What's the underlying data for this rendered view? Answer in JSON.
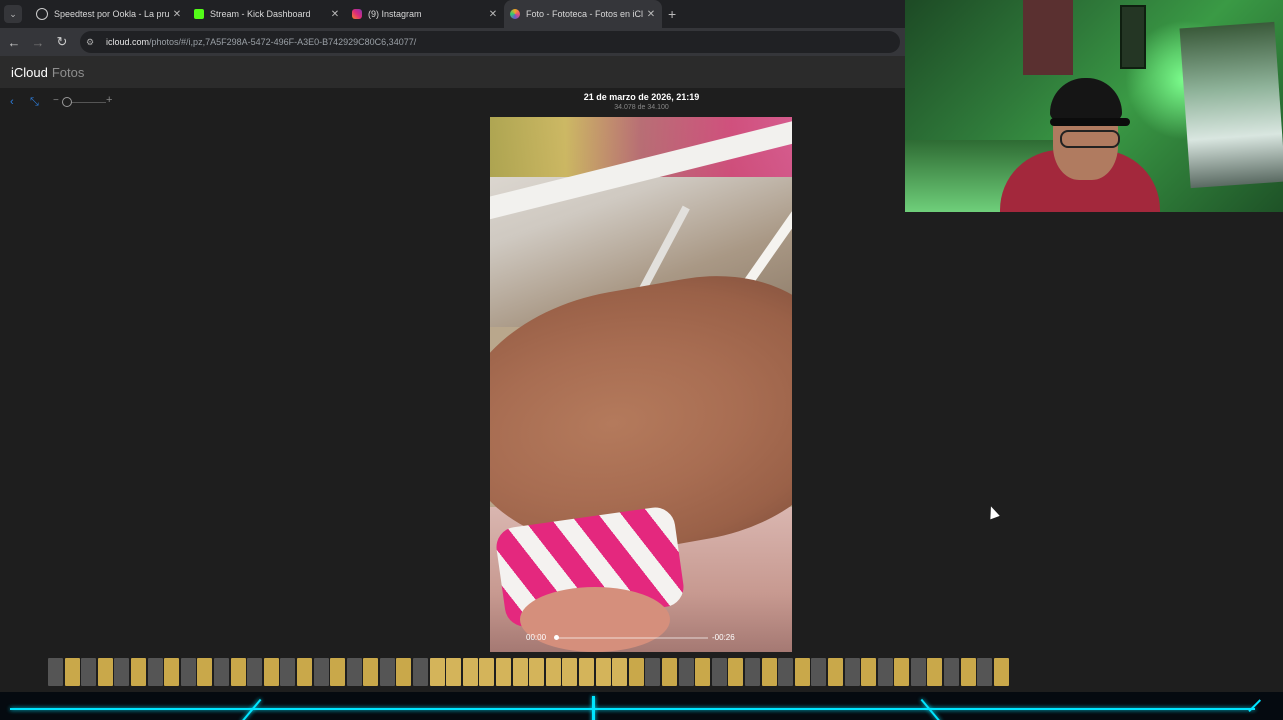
{
  "browser": {
    "tabs": [
      {
        "title": "Speedtest por Ookla - La prueb",
        "icon": "speedtest-icon",
        "color": "#cccccc"
      },
      {
        "title": "Stream - Kick Dashboard",
        "icon": "kick-icon",
        "color": "#53fc18"
      },
      {
        "title": "(9) Instagram",
        "icon": "instagram-icon",
        "color": "#e1306c"
      },
      {
        "title": "Foto - Fototeca - Fotos en iCl",
        "icon": "icloud-photos-icon",
        "color": "#f5a623",
        "active": true
      }
    ],
    "url_host": "icloud.com",
    "url_path": "/photos/#/i,pz,7A5F298A-5472-496F-A3E0-B742929C80C6,34077/"
  },
  "app": {
    "brand_main": "iCloud",
    "brand_sub": "Fotos"
  },
  "viewer": {
    "date": "21 de marzo de 2026, 21:19",
    "count": "34.078 de 34.100",
    "time_elapsed": "00:00",
    "time_remaining": "-00:26",
    "playback_progress": 0.0,
    "thumbnail_count": 58
  }
}
